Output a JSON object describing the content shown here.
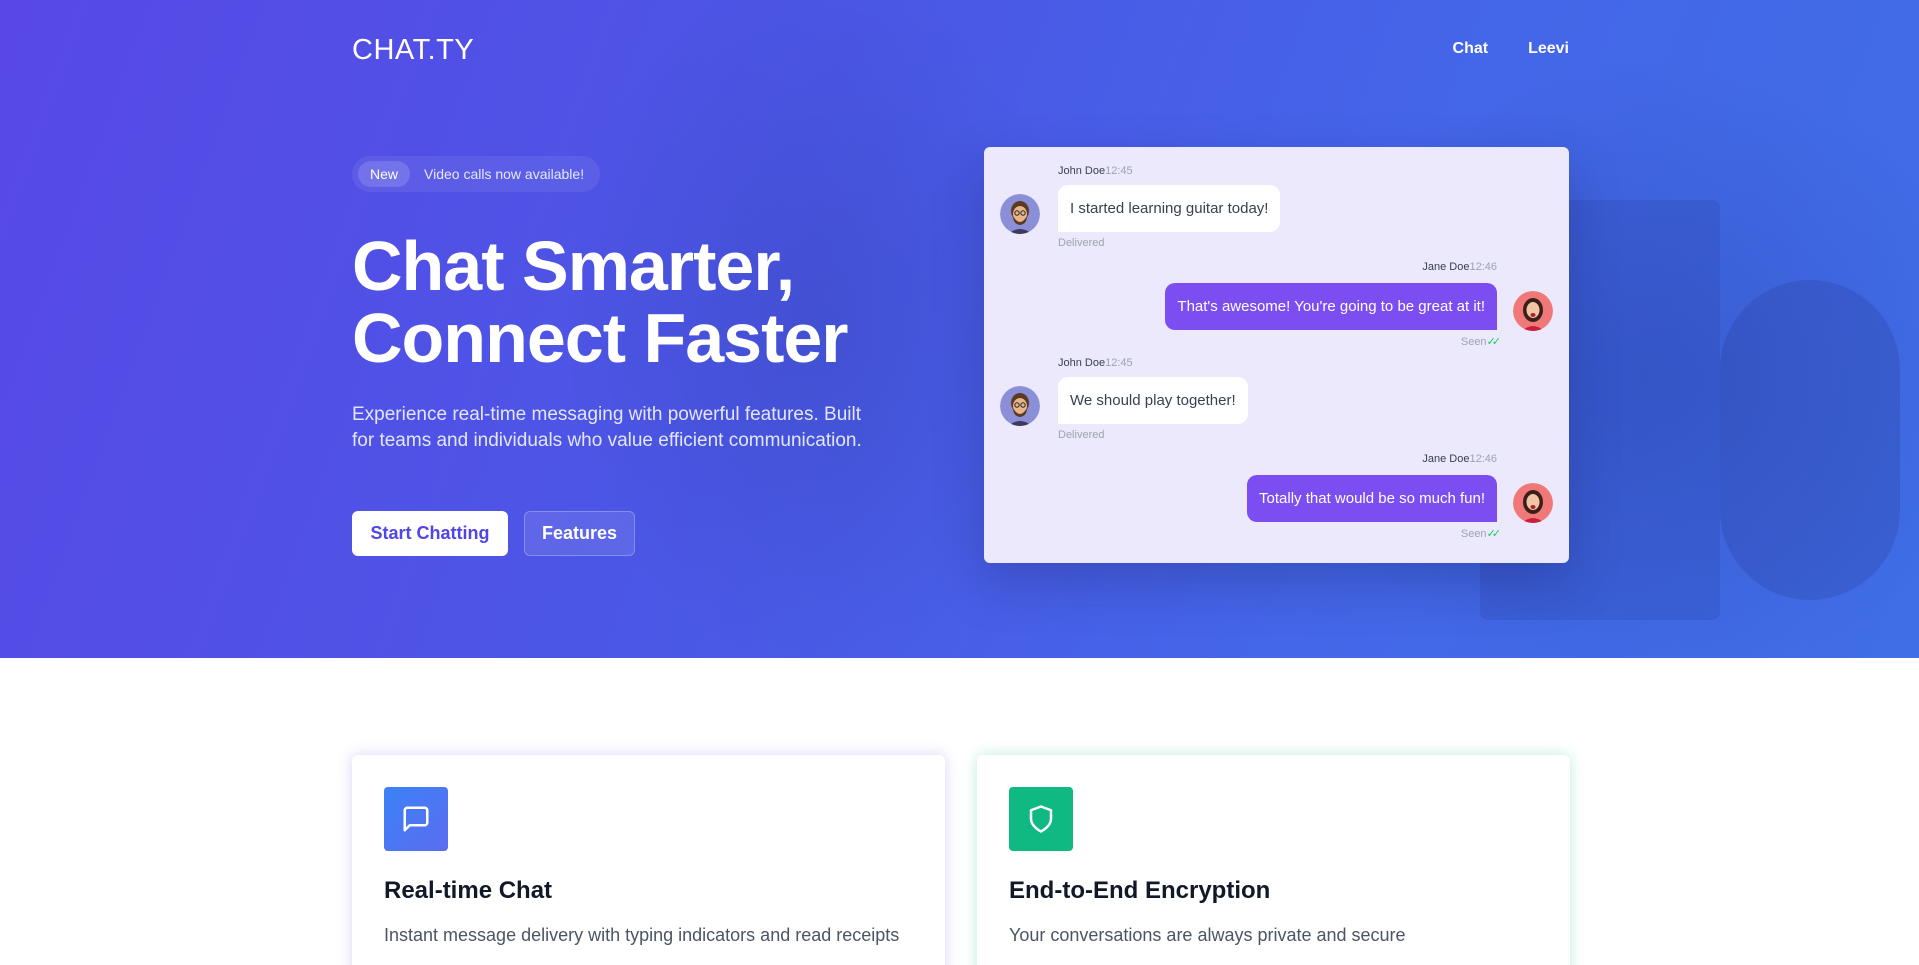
{
  "header": {
    "brand": "CHAT.TY",
    "nav": [
      "Chat",
      "Leevi"
    ]
  },
  "hero": {
    "badge_tag": "New",
    "badge_text": "Video calls now available!",
    "headline_line1": "Chat Smarter,",
    "headline_line2": "Connect Faster",
    "subtext": "Experience real-time messaging with powerful features. Built for teams and individuals who value efficient communication.",
    "primary_button": "Start Chatting",
    "secondary_button": "Features"
  },
  "chat": {
    "messages": [
      {
        "sender": "John Doe",
        "time": "12:45",
        "text": "I started learning guitar today!",
        "status": "Delivered",
        "direction": "in"
      },
      {
        "sender": "Jane Doe",
        "time": "12:46",
        "text": "That's awesome! You're going to be great at it!",
        "status": "Seen",
        "direction": "out"
      },
      {
        "sender": "John Doe",
        "time": "12:45",
        "text": "We should play together!",
        "status": "Delivered",
        "direction": "in"
      },
      {
        "sender": "Jane Doe",
        "time": "12:46",
        "text": "Totally that would be so much fun!",
        "status": "Seen",
        "direction": "out"
      }
    ]
  },
  "features": [
    {
      "icon": "chat-bubble-icon",
      "title": "Real-time Chat",
      "description": "Instant message delivery with typing indicators and read receipts",
      "accent": "#4f6ef0"
    },
    {
      "icon": "shield-icon",
      "title": "End-to-End Encryption",
      "description": "Your conversations are always private and secure",
      "accent": "#10b981"
    }
  ],
  "colors": {
    "hero_gradient_start": "#5848e6",
    "hero_gradient_end": "#3f6ee6",
    "outgoing_bubble": "#7c4ef2",
    "seen_check": "#22c55e"
  }
}
